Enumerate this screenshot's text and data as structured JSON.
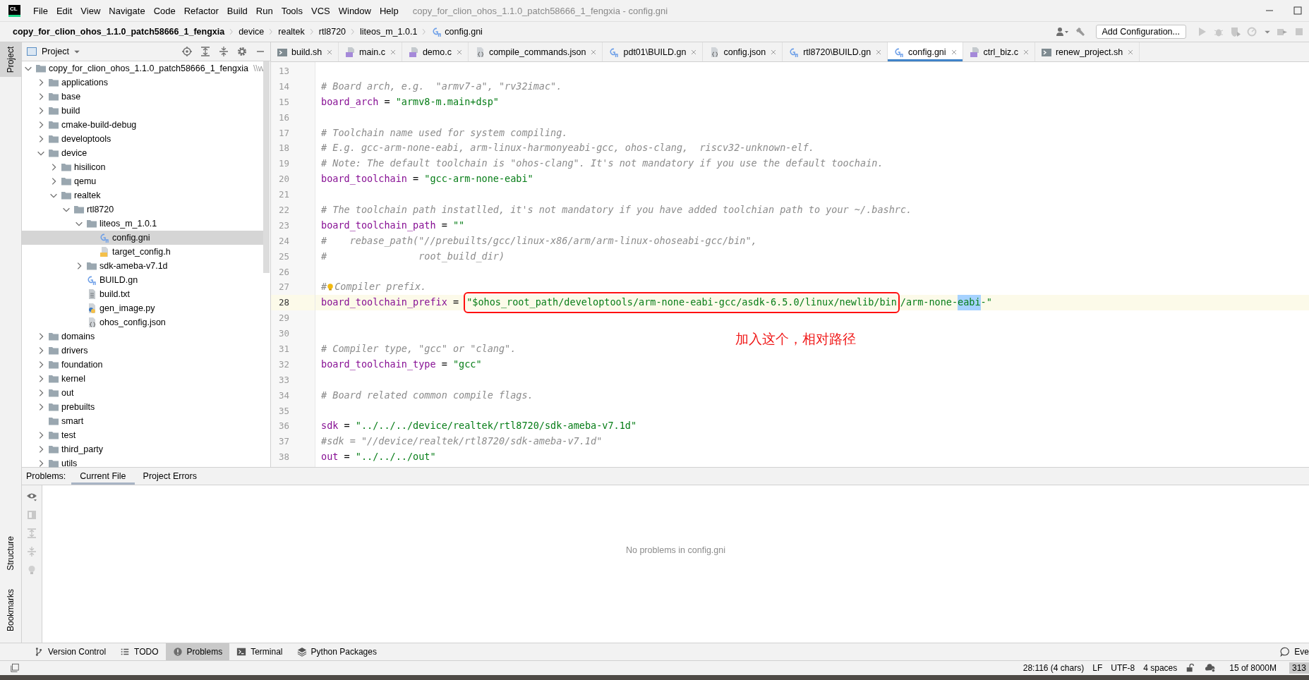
{
  "window": {
    "logo": "CL",
    "title": "copy_for_clion_ohos_1.1.0_patch58666_1_fengxia - config.gni"
  },
  "menu": [
    "File",
    "Edit",
    "View",
    "Navigate",
    "Code",
    "Refactor",
    "Build",
    "Run",
    "Tools",
    "VCS",
    "Window",
    "Help"
  ],
  "breadcrumb": [
    {
      "label": "copy_for_clion_ohos_1.1.0_patch58666_1_fengxia",
      "kind": "project"
    },
    {
      "label": "device",
      "kind": "folder"
    },
    {
      "label": "realtek",
      "kind": "folder"
    },
    {
      "label": "rtl8720",
      "kind": "folder"
    },
    {
      "label": "liteos_m_1.0.1",
      "kind": "folder"
    },
    {
      "label": "config.gni",
      "kind": "gn"
    }
  ],
  "toolbar": {
    "configuration": "Add Configuration..."
  },
  "side_tabs": [
    {
      "label": "Project",
      "selected": true
    }
  ],
  "side_tabs_bottom": [
    {
      "label": "Structure",
      "selected": false
    },
    {
      "label": "Bookmarks",
      "selected": false
    }
  ],
  "project_panel": {
    "title": "Project",
    "tree": [
      {
        "label": "copy_for_clion_ohos_1.1.0_patch58666_1_fengxia",
        "hint": "\\\\w",
        "kind": "folder",
        "expanded": true,
        "selected": false,
        "children": [
          {
            "label": "applications",
            "kind": "folder",
            "expanded": false,
            "selected": false
          },
          {
            "label": "base",
            "kind": "folder",
            "expanded": false,
            "selected": false
          },
          {
            "label": "build",
            "kind": "folder",
            "expanded": false,
            "selected": false
          },
          {
            "label": "cmake-build-debug",
            "kind": "folder",
            "expanded": false,
            "selected": false
          },
          {
            "label": "developtools",
            "kind": "folder",
            "expanded": false,
            "selected": false
          },
          {
            "label": "device",
            "kind": "folder",
            "expanded": true,
            "selected": false,
            "children": [
              {
                "label": "hisilicon",
                "kind": "folder",
                "expanded": false,
                "selected": false
              },
              {
                "label": "qemu",
                "kind": "folder",
                "expanded": false,
                "selected": false
              },
              {
                "label": "realtek",
                "kind": "folder",
                "expanded": true,
                "selected": false,
                "children": [
                  {
                    "label": "rtl8720",
                    "kind": "folder",
                    "expanded": true,
                    "selected": false,
                    "children": [
                      {
                        "label": "liteos_m_1.0.1",
                        "kind": "folder",
                        "expanded": true,
                        "selected": false,
                        "children": [
                          {
                            "label": "config.gni",
                            "kind": "gn",
                            "selected": true
                          },
                          {
                            "label": "target_config.h",
                            "kind": "h",
                            "selected": false
                          }
                        ]
                      },
                      {
                        "label": "sdk-ameba-v7.1d",
                        "kind": "folder",
                        "expanded": false,
                        "selected": false
                      },
                      {
                        "label": "BUILD.gn",
                        "kind": "gn",
                        "selected": false
                      },
                      {
                        "label": "build.txt",
                        "kind": "txt",
                        "selected": false
                      },
                      {
                        "label": "gen_image.py",
                        "kind": "py",
                        "selected": false
                      },
                      {
                        "label": "ohos_config.json",
                        "kind": "json",
                        "selected": false
                      }
                    ]
                  }
                ]
              }
            ]
          },
          {
            "label": "domains",
            "kind": "folder",
            "expanded": false,
            "selected": false
          },
          {
            "label": "drivers",
            "kind": "folder",
            "expanded": false,
            "selected": false
          },
          {
            "label": "foundation",
            "kind": "folder",
            "expanded": false,
            "selected": false
          },
          {
            "label": "kernel",
            "kind": "folder",
            "expanded": false,
            "selected": false
          },
          {
            "label": "out",
            "kind": "folder",
            "expanded": false,
            "selected": false
          },
          {
            "label": "prebuilts",
            "kind": "folder",
            "expanded": false,
            "selected": false
          },
          {
            "label": "smart",
            "kind": "leaf-folder",
            "selected": false
          },
          {
            "label": "test",
            "kind": "folder",
            "expanded": false,
            "selected": false
          },
          {
            "label": "third_party",
            "kind": "folder",
            "expanded": false,
            "selected": false
          },
          {
            "label": "utils",
            "kind": "folder",
            "expanded": false,
            "selected": false
          }
        ]
      }
    ]
  },
  "editor_tabs": [
    {
      "label": "build.sh",
      "kind": "sh",
      "selected": false
    },
    {
      "label": "main.c",
      "kind": "c",
      "selected": false
    },
    {
      "label": "demo.c",
      "kind": "c",
      "selected": false
    },
    {
      "label": "compile_commands.json",
      "kind": "json",
      "selected": false
    },
    {
      "label": "pdt01\\BUILD.gn",
      "kind": "gn",
      "selected": false
    },
    {
      "label": "config.json",
      "kind": "json",
      "selected": false
    },
    {
      "label": "rtl8720\\BUILD.gn",
      "kind": "gn",
      "selected": false
    },
    {
      "label": "config.gni",
      "kind": "gn",
      "selected": true
    },
    {
      "label": "ctrl_biz.c",
      "kind": "c",
      "selected": false
    },
    {
      "label": "renew_project.sh",
      "kind": "sh",
      "selected": false
    }
  ],
  "editor": {
    "annotation": "加入这个，相对路径",
    "lines": [
      {
        "number": "13",
        "current": false
      },
      {
        "number": "14",
        "current": false,
        "segments": [
          {
            "kind": "comment",
            "text": "# Board arch, e.g.  \"armv7-a\", \"rv32imac\"."
          }
        ]
      },
      {
        "number": "15",
        "current": false,
        "segments": [
          {
            "kind": "ident",
            "text": "board_arch"
          },
          {
            "kind": "op",
            "text": " = "
          },
          {
            "kind": "string",
            "text": "\"armv8-m.main+dsp\""
          }
        ]
      },
      {
        "number": "16",
        "current": false
      },
      {
        "number": "17",
        "current": false,
        "segments": [
          {
            "kind": "comment",
            "text": "# Toolchain name used for system compiling."
          }
        ]
      },
      {
        "number": "18",
        "current": false,
        "segments": [
          {
            "kind": "comment",
            "text": "# E.g. gcc-arm-none-eabi, arm-linux-harmonyeabi-gcc, ohos-clang,  riscv32-unknown-elf."
          }
        ]
      },
      {
        "number": "19",
        "current": false,
        "segments": [
          {
            "kind": "comment",
            "text": "# Note: The default toolchain is \"ohos-clang\". It's not mandatory if you use the default toochain."
          }
        ]
      },
      {
        "number": "20",
        "current": false,
        "segments": [
          {
            "kind": "ident",
            "text": "board_toolchain"
          },
          {
            "kind": "op",
            "text": " = "
          },
          {
            "kind": "string",
            "text": "\"gcc-arm-none-eabi\""
          }
        ]
      },
      {
        "number": "21",
        "current": false
      },
      {
        "number": "22",
        "current": false,
        "segments": [
          {
            "kind": "comment",
            "text": "# The toolchain path instatlled, it's not mandatory if you have added toolchian path to your ~/.bashrc."
          }
        ]
      },
      {
        "number": "23",
        "current": false,
        "segments": [
          {
            "kind": "ident",
            "text": "board_toolchain_path"
          },
          {
            "kind": "op",
            "text": " = "
          },
          {
            "kind": "string",
            "text": "\"\""
          }
        ]
      },
      {
        "number": "24",
        "current": false,
        "segments": [
          {
            "kind": "comment",
            "text": "#    rebase_path(\"//prebuilts/gcc/linux-x86/arm/arm-linux-ohoseabi-gcc/bin\","
          }
        ]
      },
      {
        "number": "25",
        "current": false,
        "segments": [
          {
            "kind": "comment",
            "text": "#                root_build_dir)"
          }
        ]
      },
      {
        "number": "26",
        "current": false
      },
      {
        "number": "27",
        "current": false,
        "segments": [
          {
            "kind": "comment",
            "text": "#"
          },
          {
            "kind": "bulb"
          },
          {
            "kind": "comment",
            "text": "Compiler prefix."
          }
        ]
      },
      {
        "number": "28",
        "current": true,
        "segments": [
          {
            "kind": "ident",
            "text": "board_toolchain_prefix"
          },
          {
            "kind": "op",
            "text": " = "
          },
          {
            "kind": "boxed",
            "text": "\"$ohos_root_path/developtools/arm-none-eabi-gcc/asdk-6.5.0/linux/newlib/bin"
          },
          {
            "kind": "string",
            "text": "/arm-none-"
          },
          {
            "kind": "selected",
            "text": "eabi"
          },
          {
            "kind": "string",
            "text": "-\""
          }
        ]
      },
      {
        "number": "29",
        "current": false
      },
      {
        "number": "30",
        "current": false
      },
      {
        "number": "31",
        "current": false,
        "segments": [
          {
            "kind": "comment",
            "text": "# Compiler type, \"gcc\" or \"clang\"."
          }
        ]
      },
      {
        "number": "32",
        "current": false,
        "segments": [
          {
            "kind": "ident",
            "text": "board_toolchain_type"
          },
          {
            "kind": "op",
            "text": " = "
          },
          {
            "kind": "string",
            "text": "\"gcc\""
          }
        ]
      },
      {
        "number": "33",
        "current": false
      },
      {
        "number": "34",
        "current": false,
        "segments": [
          {
            "kind": "comment",
            "text": "# Board related common compile flags."
          }
        ]
      },
      {
        "number": "35",
        "current": false
      },
      {
        "number": "36",
        "current": false,
        "segments": [
          {
            "kind": "ident",
            "text": "sdk"
          },
          {
            "kind": "op",
            "text": " = "
          },
          {
            "kind": "string",
            "text": "\"../../../device/realtek/rtl8720/sdk-ameba-v7.1d\""
          }
        ]
      },
      {
        "number": "37",
        "current": false,
        "segments": [
          {
            "kind": "comment",
            "text": "#sdk = \"//device/realtek/rtl8720/sdk-ameba-v7.1d\""
          }
        ]
      },
      {
        "number": "38",
        "current": false,
        "segments": [
          {
            "kind": "ident",
            "text": "out"
          },
          {
            "kind": "op",
            "text": " = "
          },
          {
            "kind": "string",
            "text": "\"../../../out\""
          }
        ]
      }
    ]
  },
  "problems": {
    "label": "Problems:",
    "tabs": [
      {
        "label": "Current File",
        "selected": true
      },
      {
        "label": "Project Errors",
        "selected": false
      }
    ],
    "message": "No problems in config.gni"
  },
  "tool_windows": [
    {
      "label": "Version Control",
      "kind": "branch",
      "selected": false
    },
    {
      "label": "TODO",
      "kind": "list",
      "selected": false
    },
    {
      "label": "Problems",
      "kind": "info",
      "selected": true
    },
    {
      "label": "Terminal",
      "kind": "terminal",
      "selected": false
    },
    {
      "label": "Python Packages",
      "kind": "layers",
      "selected": false
    }
  ],
  "event_log": "Eve",
  "status_bar": {
    "items": [
      "28:116 (4 chars)",
      "LF",
      "UTF-8",
      "4 spaces"
    ],
    "memory": "15 of 8000M",
    "counter": "313"
  }
}
